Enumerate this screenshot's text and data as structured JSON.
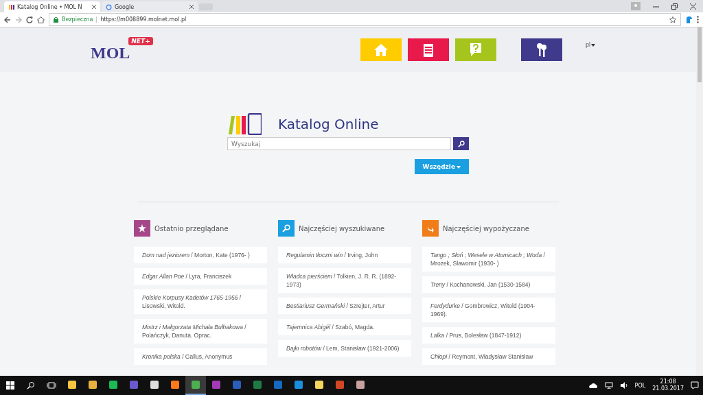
{
  "browser": {
    "tabs": [
      {
        "title": "Katalog Online • MOL N",
        "selected": true
      },
      {
        "title": "Google",
        "selected": false
      }
    ],
    "security_label": "Bezpieczna",
    "url": "https://m008899.molnet.mol.pl"
  },
  "header": {
    "logo_text": "MOL",
    "logo_badge": "NET+",
    "nav": [
      {
        "kind": "home",
        "color": "#ffcc00"
      },
      {
        "kind": "list",
        "color": "#e8194b"
      },
      {
        "kind": "help",
        "color": "#a6c51c"
      },
      {
        "kind": "login",
        "color": "#3f3a8c"
      }
    ],
    "language": "pl"
  },
  "catalog": {
    "title": "Katalog Online",
    "search": {
      "placeholder": "Wyszukaj"
    },
    "scope_button": "Wszędzie"
  },
  "columns": [
    {
      "title": "Ostatnio przeglądane",
      "kind": "star",
      "color": "#a6478a",
      "items": [
        "*Dom nad jeziorem* / Morton, Kate (1976- )",
        "*Edgar Allan Poe* / Lyra, Franciszek",
        "*Polskie Korpusy Kadetów 1765-1956* / Lisowski, Witold.",
        "*Mistrz i Małgorzata Michała Bułhakowa* / Polańczyk, Danuta. Oprac.",
        "*Kronika polska* / Gallus, Anonymus"
      ]
    },
    {
      "title": "Najczęściej wyszukiwane",
      "kind": "search",
      "color": "#1a9fe0",
      "items": [
        "*Regulamin tłoczni win* / Irving, John",
        "*Władca pierścieni* / Tolkien, J. R. R. (1892-1973)",
        "*Bestiariusz Germański* / Szrejter, Artur",
        "*Tajemnica Abigél* / Szabó, Magda.",
        "*Bajki robotów* / Lem, Stanisław (1921-2006)"
      ]
    },
    {
      "title": "Najczęściej wypożyczane",
      "kind": "return",
      "color": "#f07d1a",
      "items": [
        "*Tango ; Słoń ; Wesele w Atomicach ; Woda* / Mrożek, Sławomir (1930- )",
        "*Treny* / Kochanowski, Jan (1530-1584)",
        "*Ferdydurke* / Gombrowicz, Witold (1904-1969).",
        "*Lalka* / Prus, Bolesław (1847-1912)",
        "*Chłopi* / Reymont, Władysław Stanisław"
      ]
    }
  ],
  "taskbar": {
    "apps": [
      {
        "color": "#f5c542",
        "selected": false
      },
      {
        "color": "#e8b33c",
        "selected": false
      },
      {
        "color": "#1db954",
        "selected": false
      },
      {
        "color": "#6a5acd",
        "selected": false
      },
      {
        "color": "#dddddd",
        "selected": false
      },
      {
        "color": "#ff7a1a",
        "selected": false
      },
      {
        "color": "#4caf50",
        "selected": true
      },
      {
        "color": "#a33ab7",
        "selected": false
      },
      {
        "color": "#2b5eb8",
        "selected": false
      },
      {
        "color": "#1f7a45",
        "selected": false
      },
      {
        "color": "#1668c1",
        "selected": false
      },
      {
        "color": "#1a8fe0",
        "selected": false
      },
      {
        "color": "#f2d75c",
        "selected": false
      },
      {
        "color": "#d24726",
        "selected": false
      },
      {
        "color": "#c8a0a0",
        "selected": false
      }
    ],
    "language": "POL",
    "time": "21:08",
    "date": "21.03.2017"
  }
}
